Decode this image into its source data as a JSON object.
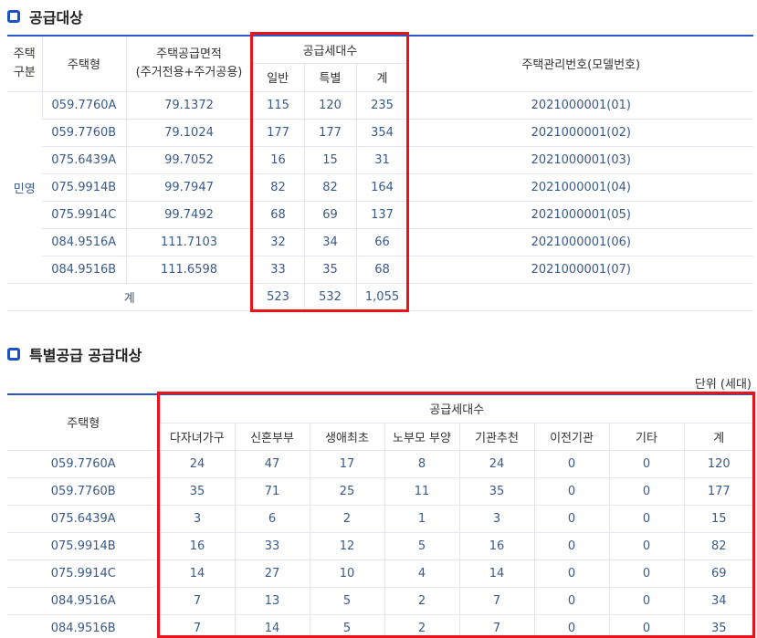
{
  "supply": {
    "title": "공급대상",
    "headers": {
      "type_group": "주택\n구분",
      "house_type": "주택형",
      "area": "주택공급면적\n(주거전용+주거공용)",
      "households": "공급세대수",
      "general": "일반",
      "special": "특별",
      "total": "계",
      "model_no": "주택관리번호(모델번호)"
    },
    "group_label": "민영",
    "rows": [
      {
        "type": "059.7760A",
        "area": "79.1372",
        "general": "115",
        "special": "120",
        "total": "235",
        "model": "2021000001(01)"
      },
      {
        "type": "059.7760B",
        "area": "79.1024",
        "general": "177",
        "special": "177",
        "total": "354",
        "model": "2021000001(02)"
      },
      {
        "type": "075.6439A",
        "area": "99.7052",
        "general": "16",
        "special": "15",
        "total": "31",
        "model": "2021000001(03)"
      },
      {
        "type": "075.9914B",
        "area": "99.7947",
        "general": "82",
        "special": "82",
        "total": "164",
        "model": "2021000001(04)"
      },
      {
        "type": "075.9914C",
        "area": "99.7492",
        "general": "68",
        "special": "69",
        "total": "137",
        "model": "2021000001(05)"
      },
      {
        "type": "084.9516A",
        "area": "111.7103",
        "general": "32",
        "special": "34",
        "total": "66",
        "model": "2021000001(06)"
      },
      {
        "type": "084.9516B",
        "area": "111.6598",
        "general": "33",
        "special": "35",
        "total": "68",
        "model": "2021000001(07)"
      }
    ],
    "sum": {
      "label": "계",
      "general": "523",
      "special": "532",
      "total": "1,055"
    }
  },
  "special_supply": {
    "title": "특별공급 공급대상",
    "unit": "단위 (세대)",
    "headers": {
      "house_type": "주택형",
      "households": "공급세대수",
      "cols": [
        "다자녀가구",
        "신혼부부",
        "생애최초",
        "노부모 부양",
        "기관추천",
        "이전기관",
        "기타",
        "계"
      ]
    },
    "rows": [
      {
        "type": "059.7760A",
        "vals": [
          "24",
          "47",
          "17",
          "8",
          "24",
          "0",
          "0",
          "120"
        ]
      },
      {
        "type": "059.7760B",
        "vals": [
          "35",
          "71",
          "25",
          "11",
          "35",
          "0",
          "0",
          "177"
        ]
      },
      {
        "type": "075.6439A",
        "vals": [
          "3",
          "6",
          "2",
          "1",
          "3",
          "0",
          "0",
          "15"
        ]
      },
      {
        "type": "075.9914B",
        "vals": [
          "16",
          "33",
          "12",
          "5",
          "16",
          "0",
          "0",
          "82"
        ]
      },
      {
        "type": "075.9914C",
        "vals": [
          "14",
          "27",
          "10",
          "4",
          "14",
          "0",
          "0",
          "69"
        ]
      },
      {
        "type": "084.9516A",
        "vals": [
          "7",
          "13",
          "5",
          "2",
          "7",
          "0",
          "0",
          "34"
        ]
      },
      {
        "type": "084.9516B",
        "vals": [
          "7",
          "14",
          "5",
          "2",
          "7",
          "0",
          "0",
          "35"
        ]
      }
    ]
  },
  "colors": {
    "accent": "#2b57c7",
    "highlight": "#e8131b",
    "cell_text": "#3a5a8a"
  }
}
